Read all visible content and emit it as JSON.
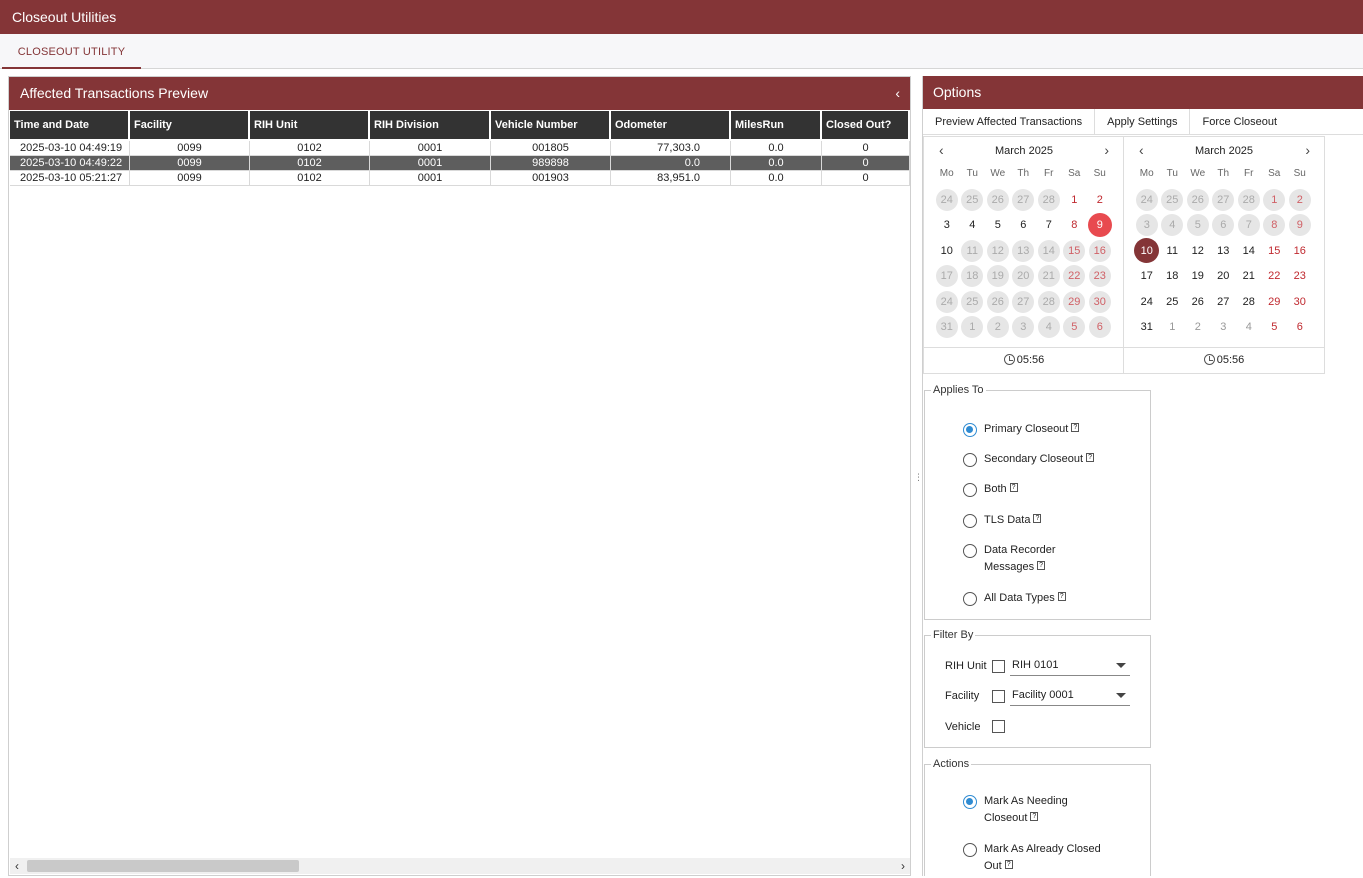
{
  "app": {
    "title": "Closeout Utilities"
  },
  "tabs": [
    {
      "label": "CLOSEOUT UTILITY"
    }
  ],
  "left_panel": {
    "title": "Affected Transactions Preview",
    "columns": [
      "Time and Date",
      "Facility",
      "RIH Unit",
      "RIH Division",
      "Vehicle Number",
      "Odometer",
      "MilesRun",
      "Closed Out?"
    ],
    "rows": [
      [
        "2025-03-10 04:49:19",
        "0099",
        "0102",
        "0001",
        "001805",
        "77,303.0",
        "0.0",
        "0"
      ],
      [
        "2025-03-10 04:49:22",
        "0099",
        "0102",
        "0001",
        "989898",
        "0.0",
        "0.0",
        "0"
      ],
      [
        "2025-03-10 05:21:27",
        "0099",
        "0102",
        "0001",
        "001903",
        "83,951.0",
        "0.0",
        "0"
      ]
    ],
    "selected_row": 1
  },
  "options": {
    "title": "Options",
    "toolbar": {
      "preview": "Preview Affected Transactions",
      "apply": "Apply Settings",
      "force": "Force Closeout"
    },
    "calendar_left": {
      "month": "March 2025",
      "weekdays": [
        "Mo",
        "Tu",
        "We",
        "Th",
        "Fr",
        "Sa",
        "Su"
      ],
      "days": [
        "24",
        "25",
        "26",
        "27",
        "28",
        "1",
        "2",
        "3",
        "4",
        "5",
        "6",
        "7",
        "8",
        "9",
        "10",
        "11",
        "12",
        "13",
        "14",
        "15",
        "16",
        "17",
        "18",
        "19",
        "20",
        "21",
        "22",
        "23",
        "24",
        "25",
        "26",
        "27",
        "28",
        "29",
        "30",
        "31",
        "1",
        "2",
        "3",
        "4",
        "5",
        "6"
      ],
      "time": "05:56"
    },
    "calendar_right": {
      "month": "March 2025",
      "weekdays": [
        "Mo",
        "Tu",
        "We",
        "Th",
        "Fr",
        "Sa",
        "Su"
      ],
      "days": [
        "24",
        "25",
        "26",
        "27",
        "28",
        "1",
        "2",
        "3",
        "4",
        "5",
        "6",
        "7",
        "8",
        "9",
        "10",
        "11",
        "12",
        "13",
        "14",
        "15",
        "16",
        "17",
        "18",
        "19",
        "20",
        "21",
        "22",
        "23",
        "24",
        "25",
        "26",
        "27",
        "28",
        "29",
        "30",
        "31",
        "1",
        "2",
        "3",
        "4",
        "5",
        "6"
      ],
      "time": "05:56"
    },
    "applies_to": {
      "legend": "Applies To",
      "items": [
        {
          "label": "Primary Closeout",
          "checked": true
        },
        {
          "label": "Secondary Closeout",
          "checked": false
        },
        {
          "label": "Both",
          "checked": false
        },
        {
          "label": "TLS Data",
          "checked": false
        },
        {
          "label": "Data Recorder",
          "label2": "Messages",
          "checked": false
        },
        {
          "label": "All Data Types",
          "checked": false
        }
      ]
    },
    "filter_by": {
      "legend": "Filter By",
      "rih_unit": {
        "label": "RIH Unit",
        "value": "RIH 0101"
      },
      "facility": {
        "label": "Facility",
        "value": "Facility 0001"
      },
      "vehicle": {
        "label": "Vehicle"
      }
    },
    "actions": {
      "legend": "Actions",
      "items": [
        {
          "label": "Mark As Needing",
          "label2": "Closeout",
          "checked": true
        },
        {
          "label": "Mark As Already Closed",
          "label2": "Out",
          "checked": false
        }
      ]
    },
    "help_glyph": "?"
  },
  "colors": {
    "brand": "#843537",
    "today": "#e84a4f",
    "radio_on": "#2f8bd2"
  }
}
